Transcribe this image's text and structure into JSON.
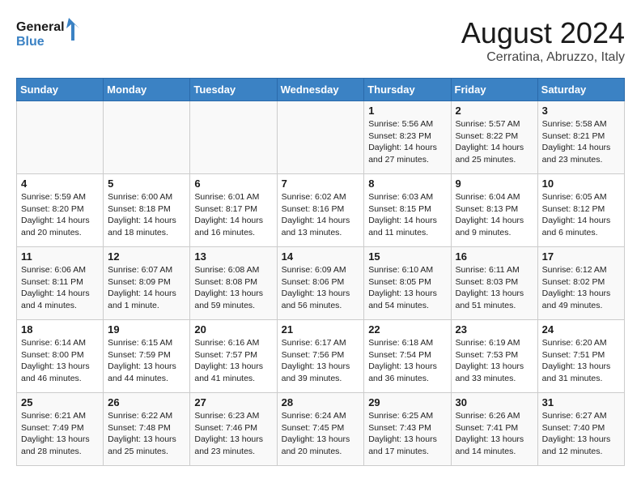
{
  "header": {
    "logo_line1": "General",
    "logo_line2": "Blue",
    "title": "August 2024",
    "subtitle": "Cerratina, Abruzzo, Italy"
  },
  "weekdays": [
    "Sunday",
    "Monday",
    "Tuesday",
    "Wednesday",
    "Thursday",
    "Friday",
    "Saturday"
  ],
  "weeks": [
    [
      {
        "day": "",
        "info": ""
      },
      {
        "day": "",
        "info": ""
      },
      {
        "day": "",
        "info": ""
      },
      {
        "day": "",
        "info": ""
      },
      {
        "day": "1",
        "info": "Sunrise: 5:56 AM\nSunset: 8:23 PM\nDaylight: 14 hours\nand 27 minutes."
      },
      {
        "day": "2",
        "info": "Sunrise: 5:57 AM\nSunset: 8:22 PM\nDaylight: 14 hours\nand 25 minutes."
      },
      {
        "day": "3",
        "info": "Sunrise: 5:58 AM\nSunset: 8:21 PM\nDaylight: 14 hours\nand 23 minutes."
      }
    ],
    [
      {
        "day": "4",
        "info": "Sunrise: 5:59 AM\nSunset: 8:20 PM\nDaylight: 14 hours\nand 20 minutes."
      },
      {
        "day": "5",
        "info": "Sunrise: 6:00 AM\nSunset: 8:18 PM\nDaylight: 14 hours\nand 18 minutes."
      },
      {
        "day": "6",
        "info": "Sunrise: 6:01 AM\nSunset: 8:17 PM\nDaylight: 14 hours\nand 16 minutes."
      },
      {
        "day": "7",
        "info": "Sunrise: 6:02 AM\nSunset: 8:16 PM\nDaylight: 14 hours\nand 13 minutes."
      },
      {
        "day": "8",
        "info": "Sunrise: 6:03 AM\nSunset: 8:15 PM\nDaylight: 14 hours\nand 11 minutes."
      },
      {
        "day": "9",
        "info": "Sunrise: 6:04 AM\nSunset: 8:13 PM\nDaylight: 14 hours\nand 9 minutes."
      },
      {
        "day": "10",
        "info": "Sunrise: 6:05 AM\nSunset: 8:12 PM\nDaylight: 14 hours\nand 6 minutes."
      }
    ],
    [
      {
        "day": "11",
        "info": "Sunrise: 6:06 AM\nSunset: 8:11 PM\nDaylight: 14 hours\nand 4 minutes."
      },
      {
        "day": "12",
        "info": "Sunrise: 6:07 AM\nSunset: 8:09 PM\nDaylight: 14 hours\nand 1 minute."
      },
      {
        "day": "13",
        "info": "Sunrise: 6:08 AM\nSunset: 8:08 PM\nDaylight: 13 hours\nand 59 minutes."
      },
      {
        "day": "14",
        "info": "Sunrise: 6:09 AM\nSunset: 8:06 PM\nDaylight: 13 hours\nand 56 minutes."
      },
      {
        "day": "15",
        "info": "Sunrise: 6:10 AM\nSunset: 8:05 PM\nDaylight: 13 hours\nand 54 minutes."
      },
      {
        "day": "16",
        "info": "Sunrise: 6:11 AM\nSunset: 8:03 PM\nDaylight: 13 hours\nand 51 minutes."
      },
      {
        "day": "17",
        "info": "Sunrise: 6:12 AM\nSunset: 8:02 PM\nDaylight: 13 hours\nand 49 minutes."
      }
    ],
    [
      {
        "day": "18",
        "info": "Sunrise: 6:14 AM\nSunset: 8:00 PM\nDaylight: 13 hours\nand 46 minutes."
      },
      {
        "day": "19",
        "info": "Sunrise: 6:15 AM\nSunset: 7:59 PM\nDaylight: 13 hours\nand 44 minutes."
      },
      {
        "day": "20",
        "info": "Sunrise: 6:16 AM\nSunset: 7:57 PM\nDaylight: 13 hours\nand 41 minutes."
      },
      {
        "day": "21",
        "info": "Sunrise: 6:17 AM\nSunset: 7:56 PM\nDaylight: 13 hours\nand 39 minutes."
      },
      {
        "day": "22",
        "info": "Sunrise: 6:18 AM\nSunset: 7:54 PM\nDaylight: 13 hours\nand 36 minutes."
      },
      {
        "day": "23",
        "info": "Sunrise: 6:19 AM\nSunset: 7:53 PM\nDaylight: 13 hours\nand 33 minutes."
      },
      {
        "day": "24",
        "info": "Sunrise: 6:20 AM\nSunset: 7:51 PM\nDaylight: 13 hours\nand 31 minutes."
      }
    ],
    [
      {
        "day": "25",
        "info": "Sunrise: 6:21 AM\nSunset: 7:49 PM\nDaylight: 13 hours\nand 28 minutes."
      },
      {
        "day": "26",
        "info": "Sunrise: 6:22 AM\nSunset: 7:48 PM\nDaylight: 13 hours\nand 25 minutes."
      },
      {
        "day": "27",
        "info": "Sunrise: 6:23 AM\nSunset: 7:46 PM\nDaylight: 13 hours\nand 23 minutes."
      },
      {
        "day": "28",
        "info": "Sunrise: 6:24 AM\nSunset: 7:45 PM\nDaylight: 13 hours\nand 20 minutes."
      },
      {
        "day": "29",
        "info": "Sunrise: 6:25 AM\nSunset: 7:43 PM\nDaylight: 13 hours\nand 17 minutes."
      },
      {
        "day": "30",
        "info": "Sunrise: 6:26 AM\nSunset: 7:41 PM\nDaylight: 13 hours\nand 14 minutes."
      },
      {
        "day": "31",
        "info": "Sunrise: 6:27 AM\nSunset: 7:40 PM\nDaylight: 13 hours\nand 12 minutes."
      }
    ]
  ]
}
